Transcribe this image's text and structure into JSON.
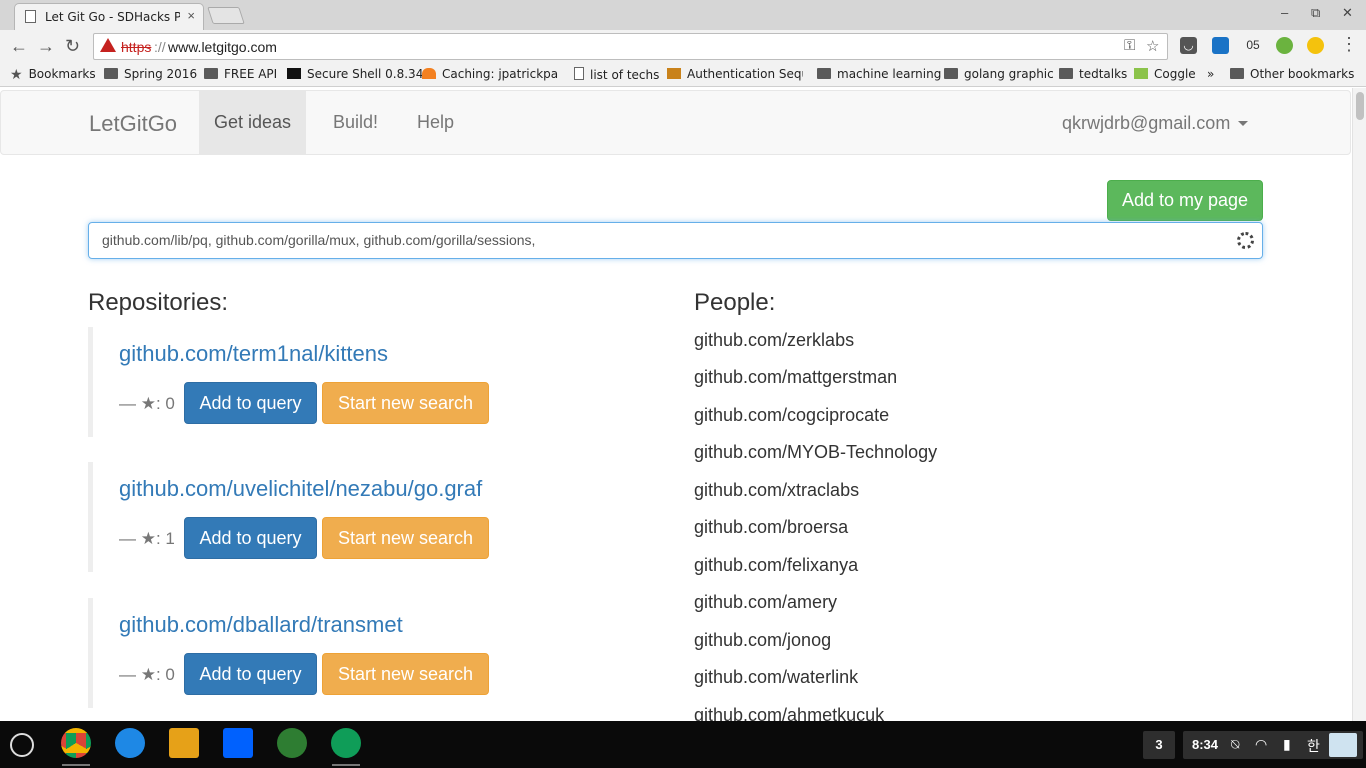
{
  "browser": {
    "tab_title": "Let Git Go - SDHacks Pro",
    "tab_close": "×",
    "win_min": "‒",
    "win_restore": "⧉",
    "win_close": "✕",
    "url_scheme": "https",
    "url_sep": "://",
    "url_host": "www.letgitgo.com",
    "ext_badge": "05"
  },
  "bookmarks": {
    "items": [
      "Bookmarks",
      "Spring 2016",
      "FREE API",
      "Secure Shell 0.8.34",
      "Caching: jpatrickpark",
      "list of techs",
      "Authentication Seque",
      "machine learning",
      "golang graphic",
      "tedtalks",
      "Coggle",
      "»",
      "Other bookmarks"
    ]
  },
  "nav": {
    "brand": "LetGitGo",
    "links": [
      "Get ideas",
      "Build!",
      "Help"
    ],
    "user": "qkrwjdrb@gmail.com"
  },
  "main": {
    "add_page_label": "Add to my page",
    "query_value": "github.com/lib/pq, github.com/gorilla/mux, github.com/gorilla/sessions,",
    "repos_title": "Repositories:",
    "people_title": "People:",
    "add_query_label": "Add to query",
    "new_search_label": "Start new search",
    "repos": [
      {
        "name": "github.com/term1nal/kittens",
        "stars": "— ★: 0"
      },
      {
        "name": "github.com/uvelichitel/nezabu/go.graf",
        "stars": "— ★: 1"
      },
      {
        "name": "github.com/dballard/transmet",
        "stars": "— ★: 0"
      }
    ],
    "people": [
      "github.com/zerklabs",
      "github.com/mattgerstman",
      "github.com/cogciprocate",
      "github.com/MYOB-Technology",
      "github.com/xtraclabs",
      "github.com/broersa",
      "github.com/felixanya",
      "github.com/amery",
      "github.com/jonog",
      "github.com/waterlink",
      "github.com/ahmetkucuk"
    ]
  },
  "shelf": {
    "notification_count": "3",
    "time": "8:34",
    "ime": "한"
  },
  "colors": {
    "primary": "#337ab7",
    "success": "#5cb85c",
    "warning": "#f0ad4e"
  }
}
